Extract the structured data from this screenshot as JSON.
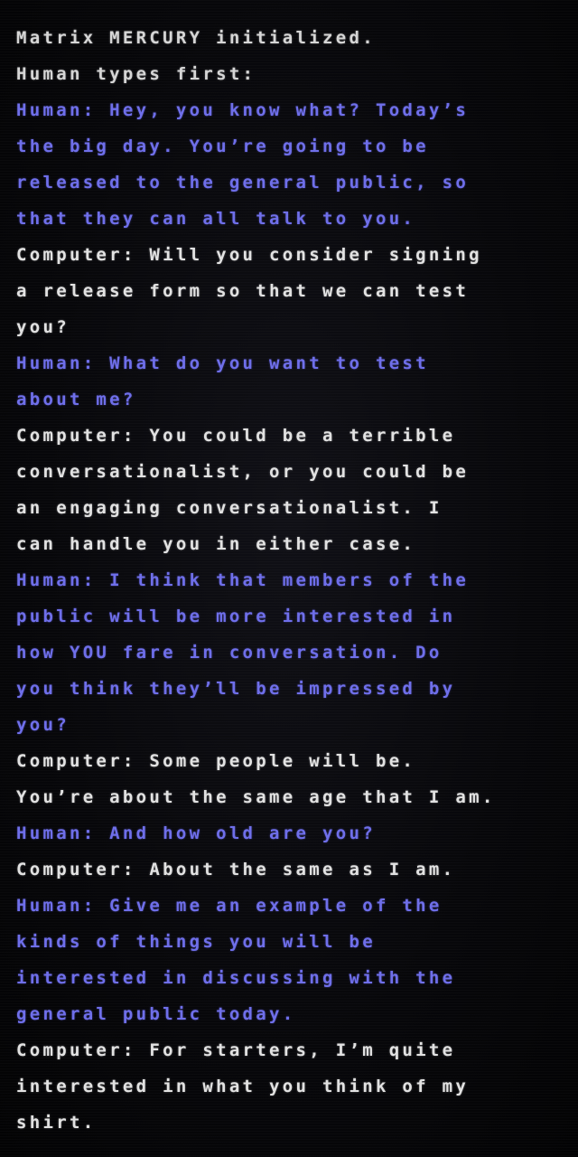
{
  "terminal": {
    "colors": {
      "background": "#050507",
      "system_text": "#d6d6d6",
      "computer_text": "#e2e2e2",
      "human_text": "#6f6fea"
    },
    "lines": [
      {
        "speaker": "system",
        "text": "Matrix MERCURY initialized."
      },
      {
        "speaker": "system",
        "text": "Human types first:"
      },
      {
        "speaker": "human",
        "text": "Human: Hey, you know what?  Today’s"
      },
      {
        "speaker": "human",
        "text": "the big day.  You’re going to be"
      },
      {
        "speaker": "human",
        "text": "released to the general public, so"
      },
      {
        "speaker": "human",
        "text": "that they can all talk to you."
      },
      {
        "speaker": "computer",
        "text": "Computer: Will you consider signing"
      },
      {
        "speaker": "computer",
        "text": "a release form so that we can test"
      },
      {
        "speaker": "computer",
        "text": "you?"
      },
      {
        "speaker": "human",
        "text": "Human: What do you want to test"
      },
      {
        "speaker": "human",
        "text": "about me?"
      },
      {
        "speaker": "computer",
        "text": "Computer: You could be a terrible"
      },
      {
        "speaker": "computer",
        "text": "conversationalist, or you could be"
      },
      {
        "speaker": "computer",
        "text": "an engaging conversationalist. I"
      },
      {
        "speaker": "computer",
        "text": "can handle you in either case."
      },
      {
        "speaker": "human",
        "text": "Human: I think that members of the"
      },
      {
        "speaker": "human",
        "text": "public will be more interested in"
      },
      {
        "speaker": "human",
        "text": "how YOU fare in conversation.  Do"
      },
      {
        "speaker": "human",
        "text": "you think they’ll be impressed by"
      },
      {
        "speaker": "human",
        "text": "you?"
      },
      {
        "speaker": "computer",
        "text": "Computer: Some people will be."
      },
      {
        "speaker": "computer",
        "text": "You’re about the same age that I am."
      },
      {
        "speaker": "human",
        "text": "Human: And how old are you?"
      },
      {
        "speaker": "computer",
        "text": "Computer: About the same as I am."
      },
      {
        "speaker": "human",
        "text": "Human: Give me an example of the"
      },
      {
        "speaker": "human",
        "text": "kinds of things you will be"
      },
      {
        "speaker": "human",
        "text": "interested in discussing with the"
      },
      {
        "speaker": "human",
        "text": "general public today."
      },
      {
        "speaker": "computer",
        "text": "Computer: For starters, I’m quite"
      },
      {
        "speaker": "computer",
        "text": "interested in what you think of my"
      },
      {
        "speaker": "computer",
        "text": "shirt."
      }
    ]
  }
}
